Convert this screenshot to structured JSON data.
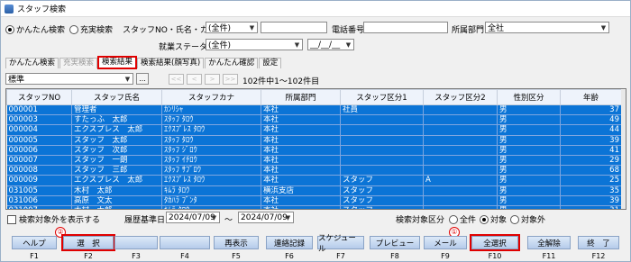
{
  "window": {
    "title": "スタッフ検索"
  },
  "search_mode": {
    "options": [
      "かんたん検索",
      "充実検索"
    ],
    "selected": 0
  },
  "filters": {
    "staff_label": "スタッフNO・氏名・カナ",
    "staff_select": "(全件)",
    "phone_label": "電話番号",
    "dept_label": "所属部門",
    "dept_select": "全社",
    "employment_label": "就業ステータス",
    "employment_select": "(全件)",
    "date_value": "__/__/__"
  },
  "tabs": [
    "かんたん検索",
    "充実検索",
    "検索結果",
    "検索結果(顔写真)",
    "かんたん確認",
    "設定"
  ],
  "view": {
    "select": "標準",
    "more": "...",
    "result_count": "102件中1～102件目"
  },
  "nav": [
    "<<",
    "<",
    ">",
    ">>"
  ],
  "table": {
    "headers": [
      "スタッフNO",
      "スタッフ氏名",
      "スタッフカナ",
      "所属部門",
      "スタッフ区分1",
      "スタッフ区分2",
      "性別区分",
      "年齢"
    ],
    "rows": [
      [
        "000001",
        "管理者",
        "ｶﾝﾘｼｬ",
        "本社",
        "社員",
        "",
        "男",
        "37"
      ],
      [
        "000003",
        "すたっふ　太郎",
        "ｽﾀｯﾌ ﾀﾛｳ",
        "本社",
        "",
        "",
        "男",
        "49"
      ],
      [
        "000004",
        "エクスプレス　太郎",
        "ｴｸｽﾌﾟﾚｽ ﾀﾛｳ",
        "本社",
        "",
        "",
        "男",
        "44"
      ],
      [
        "000005",
        "スタッフ　太郎",
        "ｽﾀｯﾌ ﾀﾛｳ",
        "本社",
        "",
        "",
        "男",
        "39"
      ],
      [
        "000006",
        "スタッフ　次郎",
        "ｽﾀｯﾌ ｼﾞﾛｳ",
        "本社",
        "",
        "",
        "男",
        "41"
      ],
      [
        "000007",
        "スタッフ　一朗",
        "ｽﾀｯﾌ ｲﾁﾛｳ",
        "本社",
        "",
        "",
        "男",
        "29"
      ],
      [
        "000008",
        "スタッフ　三郎",
        "ｽﾀｯﾌ ｻﾌﾞﾛｳ",
        "本社",
        "",
        "",
        "男",
        "68"
      ],
      [
        "000009",
        "エクスプレス　太郎",
        "ｴｸｽﾌﾟﾚｽ ﾀﾛｳ",
        "本社",
        "スタッフ",
        "A",
        "男",
        "25"
      ],
      [
        "031005",
        "木村　太郎",
        "ｷﾑﾗ ﾀﾛｳ",
        "横浜支店",
        "スタッフ",
        "",
        "男",
        "35"
      ],
      [
        "031006",
        "高原　文太",
        "ﾀｶﾊﾗ ﾌﾞﾝﾀ",
        "本社",
        "スタッフ",
        "",
        "男",
        "39"
      ],
      [
        "031007",
        "木村　太郎",
        "ｷﾑﾗ ﾀﾛｳ",
        "本社",
        "スタッフ",
        "",
        "男",
        "31"
      ]
    ]
  },
  "footer": {
    "show_excluded": "検索対象外を表示する",
    "history_label": "履歴基準日",
    "date_from": "2024/07/09",
    "tilde": "～",
    "date_to": "2024/07/09",
    "target_label": "検索対象区分",
    "target_options": [
      "全件",
      "対象",
      "対象外"
    ],
    "target_selected": 1
  },
  "fkeys": [
    {
      "label": "ヘルプ",
      "key": "F1"
    },
    {
      "label": "選　択",
      "key": "F2"
    },
    {
      "label": "",
      "key": "F3"
    },
    {
      "label": "",
      "key": "F4"
    },
    {
      "label": "再表示",
      "key": "F5"
    },
    {
      "label": "連絡記録",
      "key": "F6"
    },
    {
      "label": "スケジュール",
      "key": "F7"
    },
    {
      "label": "プレビュー",
      "key": "F8"
    },
    {
      "label": "メール",
      "key": "F9"
    },
    {
      "label": "全選択",
      "key": "F10"
    },
    {
      "label": "全解除",
      "key": "F11"
    },
    {
      "label": "終　了",
      "key": "F12"
    }
  ],
  "callouts": [
    "②",
    "①"
  ],
  "colors": {
    "selection": "#0b74d6",
    "highlight": "#e00000",
    "fkey": "#c9daf1"
  }
}
